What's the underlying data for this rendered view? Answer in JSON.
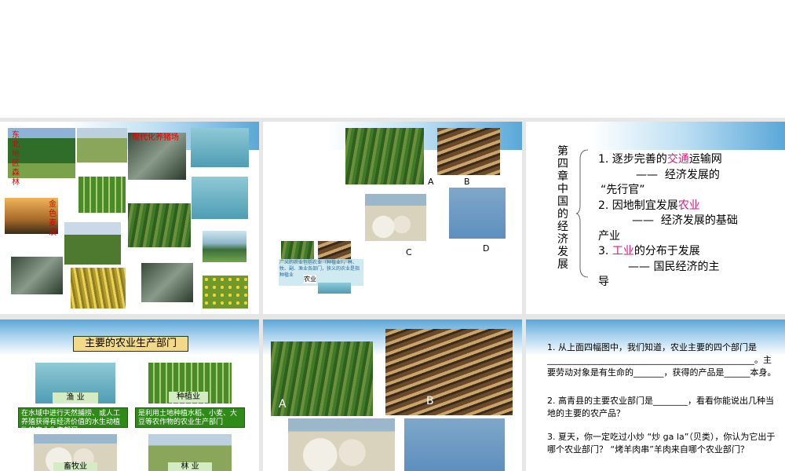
{
  "slide1": {
    "red_vertical": "东北地区森林",
    "red_modern": "现代化养猪场",
    "red_wave": "金色麦浪"
  },
  "slide2": {
    "labels": [
      "A",
      "B",
      "C",
      "D"
    ],
    "inset_text": "广义的农业包括农业（种植业），林、牧、副、渔业各部门，狭义的农业是指种植业",
    "inset_keyword": "农业"
  },
  "slide3": {
    "chapter_title": "第四章 中国的经济发展",
    "line1_pre": "1. 逐步完善的",
    "line1_hl": "交通",
    "line1_post": "运输网",
    "line2": "——  经济发展的",
    "line3": "“先行官”",
    "line4_pre": "2. 因地制宜发展",
    "line4_hl": "农业",
    "line5": "——  经济发展的基础",
    "line6": "产业",
    "line7_pre": "3. ",
    "line7_hl": "工业",
    "line7_post": "的分布于发展",
    "line8": "—— 国民经济的主",
    "line9": "导"
  },
  "slide4": {
    "title": "主要的农业生产部门",
    "btn_fishery": "渔 业",
    "btn_planting": "种植业",
    "btn_herding": "畜牧业",
    "btn_forestry": "林 业",
    "desc_fishery": "在水域中进行天然捕捞、或人工养殖获得有经济价值的水生动植物的农业生产部门",
    "desc_planting": "是利用土地种植水稻、小麦、大豆等农作物的农业生产部门"
  },
  "slide5": {
    "labels": [
      "A",
      "B"
    ]
  },
  "slide6": {
    "q1": "1. 从上面四幅图中，我们知道，农业主要的四个部门是________________________________________________。主要劳动对象是有生命的_______，获得的产品是______本身。",
    "q2": "2. 高青县的主要农业部门是________，看看你能说出几种当地的主要的农产品？",
    "q3": "3. 夏天，你一定吃过小炒 “炒  ga  la”（贝类），你认为它出于哪个农业部门？     “烤羊肉串”羊肉来自哪个农业部门？"
  }
}
